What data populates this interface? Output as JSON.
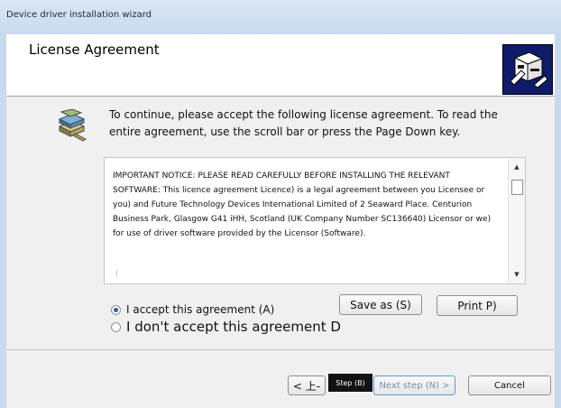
{
  "window": {
    "title": "Device driver installation wizard"
  },
  "header": {
    "title": "License Agreement",
    "icon": "hardware-install-icon"
  },
  "instruction": "To continue, please accept the following license agreement. To read the entire agreement, use the scroll bar or press the Page Down key.",
  "license": {
    "text": "IMPORTANT NOTICE: PLEASE READ CAREFULLY BEFORE INSTALLING THE RELEVANT SOFTWARE: This licence agreement Licence) is a legal agreement between you Licensee or you) and Future Technology Devices International Limited of 2 Seaward Place. Centurion Business Park, Glasgow G41 iHH, Scotland (UK Company Number SC136640) Licensor or we) for use of driver software provided by the Licensor (Software)."
  },
  "options": {
    "accept_label": "I accept this agreement (A)",
    "decline_label": "I don't accept this agreement D",
    "selected": "accept"
  },
  "buttons": {
    "save_as": "Save as (S)",
    "print": "Print P)",
    "back": "< 上-",
    "tooltip": "Step (B)",
    "next": "Next step (N) >",
    "cancel": "Cancel"
  },
  "colors": {
    "header_icon_bg": "#0f1a6b",
    "next_text": "#6f8fb5",
    "radio_selected": "#2a62b8"
  }
}
